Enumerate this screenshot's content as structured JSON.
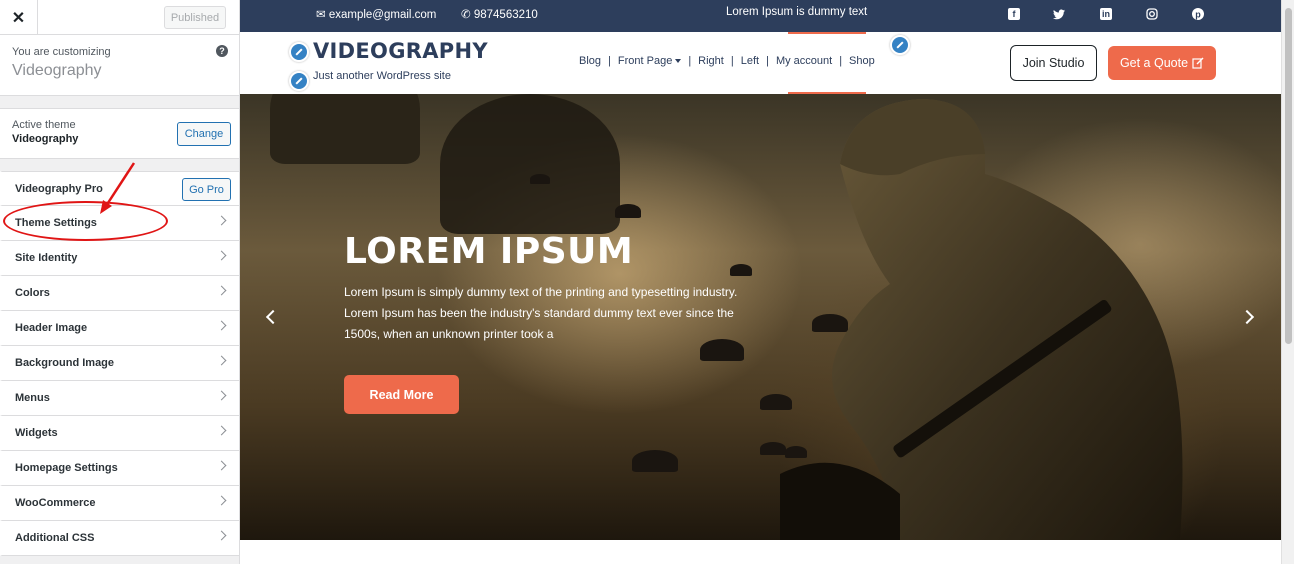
{
  "sidebar": {
    "close_icon": "close-icon",
    "published_label": "Published",
    "customizing_label": "You are customizing",
    "site_name": "Videography",
    "help_icon": "help-icon",
    "active_theme_label": "Active theme",
    "active_theme_name": "Videography",
    "change_label": "Change",
    "pro_label": "Videography Pro",
    "go_pro_label": "Go Pro",
    "items": [
      {
        "label": "Theme Settings"
      },
      {
        "label": "Site Identity"
      },
      {
        "label": "Colors"
      },
      {
        "label": "Header Image"
      },
      {
        "label": "Background Image"
      },
      {
        "label": "Menus"
      },
      {
        "label": "Widgets"
      },
      {
        "label": "Homepage Settings"
      },
      {
        "label": "WooCommerce"
      },
      {
        "label": "Additional CSS"
      }
    ],
    "annotation_color": "#e01515"
  },
  "topbar": {
    "email": "example@gmail.com",
    "phone": "9874563210",
    "tagline": "Lorem Ipsum is dummy text",
    "social_icons": [
      "facebook-icon",
      "twitter-icon",
      "linkedin-icon",
      "instagram-icon",
      "pinterest-icon"
    ]
  },
  "header": {
    "site_title": "VIDEOGRAPHY",
    "site_tagline": "Just another WordPress site",
    "nav": [
      {
        "label": "Blog"
      },
      {
        "label": "Front Page",
        "dropdown": true
      },
      {
        "label": "Right"
      },
      {
        "label": "Left"
      },
      {
        "label": "My account",
        "active": true
      },
      {
        "label": "Shop"
      }
    ],
    "join_label": "Join Studio",
    "quote_label": "Get a Quote"
  },
  "hero": {
    "title": "LOREM IPSUM",
    "text": "Lorem Ipsum is simply dummy text of the printing and typesetting industry. Lorem Ipsum has been the industry's standard dummy text ever since the 1500s, when an unknown printer took a",
    "button_label": "Read More"
  },
  "colors": {
    "accent": "#ee6a4b",
    "navy": "#2d3e5c",
    "wp_blue": "#2271b1"
  }
}
